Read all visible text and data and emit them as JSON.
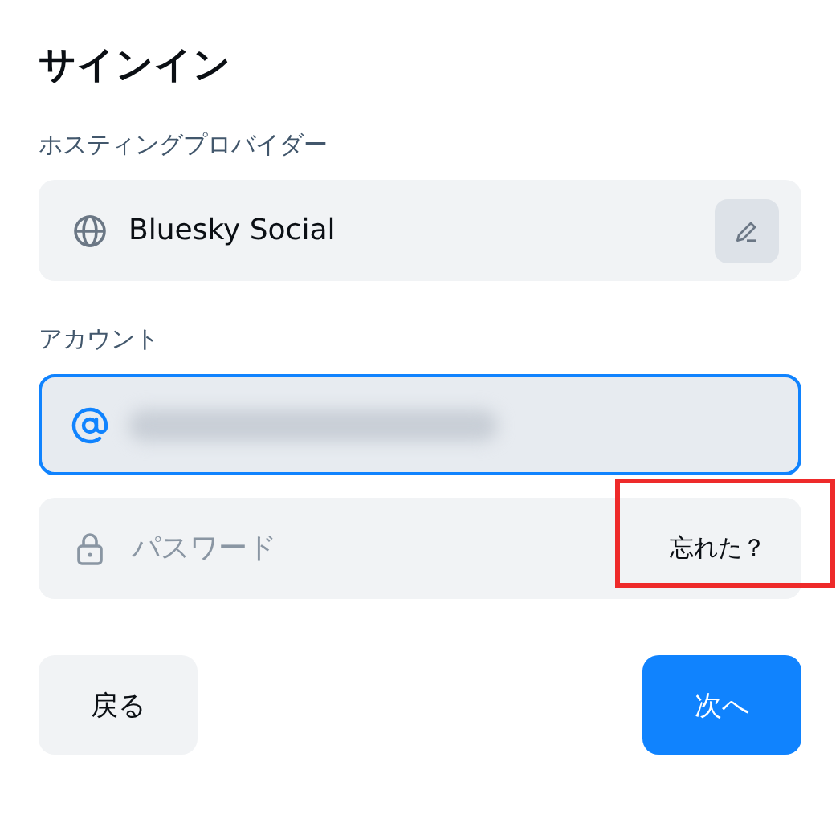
{
  "title": "サインイン",
  "provider": {
    "label": "ホスティングプロバイダー",
    "value": "Bluesky Social"
  },
  "account": {
    "label": "アカウント",
    "focused": true,
    "redacted": true
  },
  "password": {
    "placeholder": "パスワード",
    "forgot": "忘れた？",
    "highlighted": true
  },
  "buttons": [
    {
      "label": "戻る",
      "kind": "secondary"
    },
    {
      "label": "次へ",
      "kind": "primary"
    }
  ]
}
